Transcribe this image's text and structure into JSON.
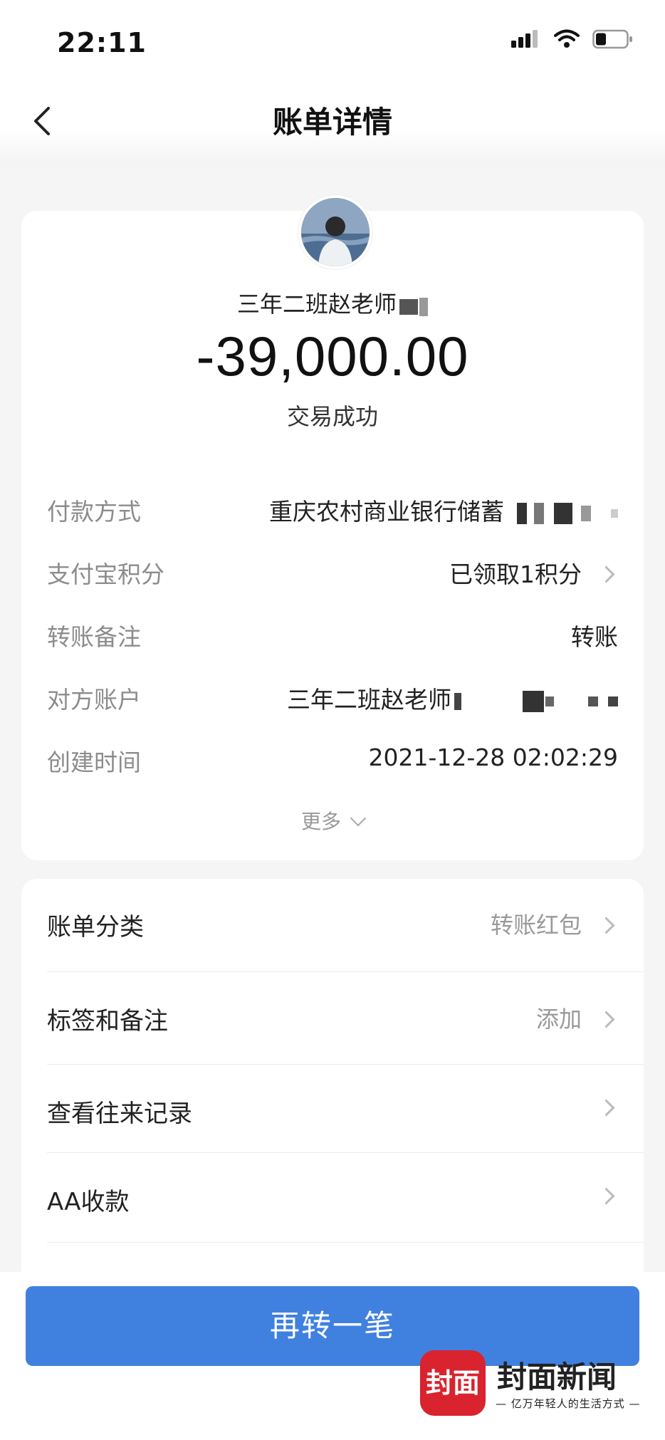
{
  "status_bar": {
    "time": "22:11"
  },
  "header": {
    "title": "账单详情"
  },
  "transaction": {
    "payee": "三年二班赵老师",
    "amount": "-39,000.00",
    "status": "交易成功"
  },
  "details": [
    {
      "label": "付款方式",
      "value": "重庆农村商业银行储蓄"
    },
    {
      "label": "支付宝积分",
      "value": "已领取1积分"
    },
    {
      "label": "转账备注",
      "value": "转账"
    },
    {
      "label": "对方账户",
      "value": "三年二班赵老师"
    },
    {
      "label": "创建时间",
      "value": "2021-12-28 02:02:29"
    }
  ],
  "more_label": "更多",
  "menu": [
    {
      "label": "账单分类",
      "value": "转账红包"
    },
    {
      "label": "标签和备注",
      "value": "添加"
    },
    {
      "label": "查看往来记录",
      "value": ""
    },
    {
      "label": "AA收款",
      "value": ""
    }
  ],
  "transfer_again_label": "再转一笔",
  "watermark": {
    "logo_text": "封面",
    "name": "封面新闻",
    "slogan": "— 亿万年轻人的生活方式 —"
  },
  "colors": {
    "primary_button": "#4081e0",
    "brand_red": "#d9232e"
  }
}
